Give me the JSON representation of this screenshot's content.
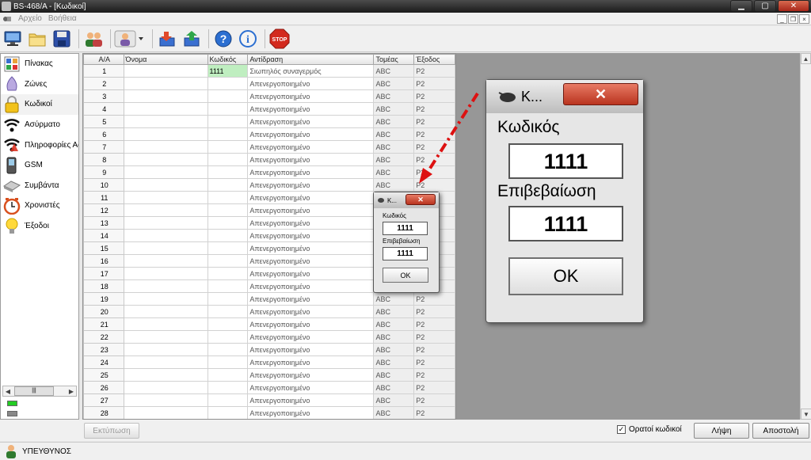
{
  "window": {
    "title": "BS-468/A - [Κωδικοί]",
    "buttons": {
      "minimize": "▁",
      "maximize": "▢",
      "close": "✕"
    }
  },
  "menu": {
    "items": [
      "Αρχείο",
      "Βοήθεια"
    ]
  },
  "toolbar": {
    "icons": [
      "monitor-icon",
      "folder-icon",
      "save-icon",
      "users-icon",
      "user-dropdown-icon",
      "download-icon",
      "upload-icon",
      "help-icon",
      "info-icon",
      "stop-icon"
    ],
    "stop_label": "STOP"
  },
  "sidebar": {
    "items": [
      {
        "label": "Πίνακας",
        "icon": "panel-icon"
      },
      {
        "label": "Ζώνες",
        "icon": "zones-icon"
      },
      {
        "label": "Κωδικοί",
        "icon": "lock-icon"
      },
      {
        "label": "Ασύρματο",
        "icon": "wireless-icon"
      },
      {
        "label": "Πληροφορίες Ασ",
        "icon": "wireless-info-icon"
      },
      {
        "label": "GSM",
        "icon": "phone-icon"
      },
      {
        "label": "Συμβάντα",
        "icon": "events-icon"
      },
      {
        "label": "Χρονιστές",
        "icon": "clock-icon"
      },
      {
        "label": "Έξοδοι",
        "icon": "bulb-icon"
      }
    ],
    "selected_index": 2,
    "scroll_thumb": "|||",
    "led_colors": [
      "#22cc22",
      "#888888"
    ]
  },
  "table": {
    "columns": [
      "Α/Α",
      "Όνομα",
      "Κωδικός",
      "Αντίδραση",
      "Τομέας",
      "Έξοδος"
    ],
    "rows": [
      [
        "1",
        "",
        "1111",
        "Σιωπηλός συναγερμός",
        "ABC",
        "P2"
      ],
      [
        "2",
        "",
        "",
        "Απενεργοποιημένο",
        "ABC",
        "P2"
      ],
      [
        "3",
        "",
        "",
        "Απενεργοποιημένο",
        "ABC",
        "P2"
      ],
      [
        "4",
        "",
        "",
        "Απενεργοποιημένο",
        "ABC",
        "P2"
      ],
      [
        "5",
        "",
        "",
        "Απενεργοποιημένο",
        "ABC",
        "P2"
      ],
      [
        "6",
        "",
        "",
        "Απενεργοποιημένο",
        "ABC",
        "P2"
      ],
      [
        "7",
        "",
        "",
        "Απενεργοποιημένο",
        "ABC",
        "P2"
      ],
      [
        "8",
        "",
        "",
        "Απενεργοποιημένο",
        "ABC",
        "P2"
      ],
      [
        "9",
        "",
        "",
        "Απενεργοποιημένο",
        "ABC",
        "P2"
      ],
      [
        "10",
        "",
        "",
        "Απενεργοποιημένο",
        "ABC",
        "P2"
      ],
      [
        "11",
        "",
        "",
        "Απενεργοποιημένο",
        "",
        ""
      ],
      [
        "12",
        "",
        "",
        "Απενεργοποιημένο",
        "",
        ""
      ],
      [
        "13",
        "",
        "",
        "Απενεργοποιημένο",
        "",
        ""
      ],
      [
        "14",
        "",
        "",
        "Απενεργοποιημένο",
        "",
        ""
      ],
      [
        "15",
        "",
        "",
        "Απενεργοποιημένο",
        "",
        ""
      ],
      [
        "16",
        "",
        "",
        "Απενεργοποιημένο",
        "",
        ""
      ],
      [
        "17",
        "",
        "",
        "Απενεργοποιημένο",
        "",
        ""
      ],
      [
        "18",
        "",
        "",
        "Απενεργοποιημένο",
        "",
        ""
      ],
      [
        "19",
        "",
        "",
        "Απενεργοποιημένο",
        "ABC",
        "P2"
      ],
      [
        "20",
        "",
        "",
        "Απενεργοποιημένο",
        "ABC",
        "P2"
      ],
      [
        "21",
        "",
        "",
        "Απενεργοποιημένο",
        "ABC",
        "P2"
      ],
      [
        "22",
        "",
        "",
        "Απενεργοποιημένο",
        "ABC",
        "P2"
      ],
      [
        "23",
        "",
        "",
        "Απενεργοποιημένο",
        "ABC",
        "P2"
      ],
      [
        "24",
        "",
        "",
        "Απενεργοποιημένο",
        "ABC",
        "P2"
      ],
      [
        "25",
        "",
        "",
        "Απενεργοποιημένο",
        "ABC",
        "P2"
      ],
      [
        "26",
        "",
        "",
        "Απενεργοποιημένο",
        "ABC",
        "P2"
      ],
      [
        "27",
        "",
        "",
        "Απενεργοποιημένο",
        "ABC",
        "P2"
      ],
      [
        "28",
        "",
        "",
        "Απενεργοποιημένο",
        "ABC",
        "P2"
      ]
    ],
    "highlight_color": "#bfeec0"
  },
  "bottom": {
    "print_label": "Εκτύπωση",
    "visible_codes_label": "Ορατοί κωδικοί",
    "visible_codes_checked": "✓",
    "receive_label": "Λήψη",
    "send_label": "Αποστολή"
  },
  "status": {
    "user": "ΥΠΕΥΘΥΝΟΣ"
  },
  "dialog_small": {
    "title": "Κ...",
    "code_label": "Κωδικός",
    "code_value": "1111",
    "confirm_label": "Επιβεβαίωση",
    "confirm_value": "1111",
    "ok_label": "OK"
  },
  "dialog_zoom": {
    "title": "Κ...",
    "code_label": "Κωδικός",
    "code_value": "1111",
    "confirm_label": "Επιβεβαίωση",
    "confirm_value": "1111",
    "ok_label": "OK"
  },
  "colors": {
    "arrow": "#dd1111",
    "accent_close": "#c8402a"
  }
}
